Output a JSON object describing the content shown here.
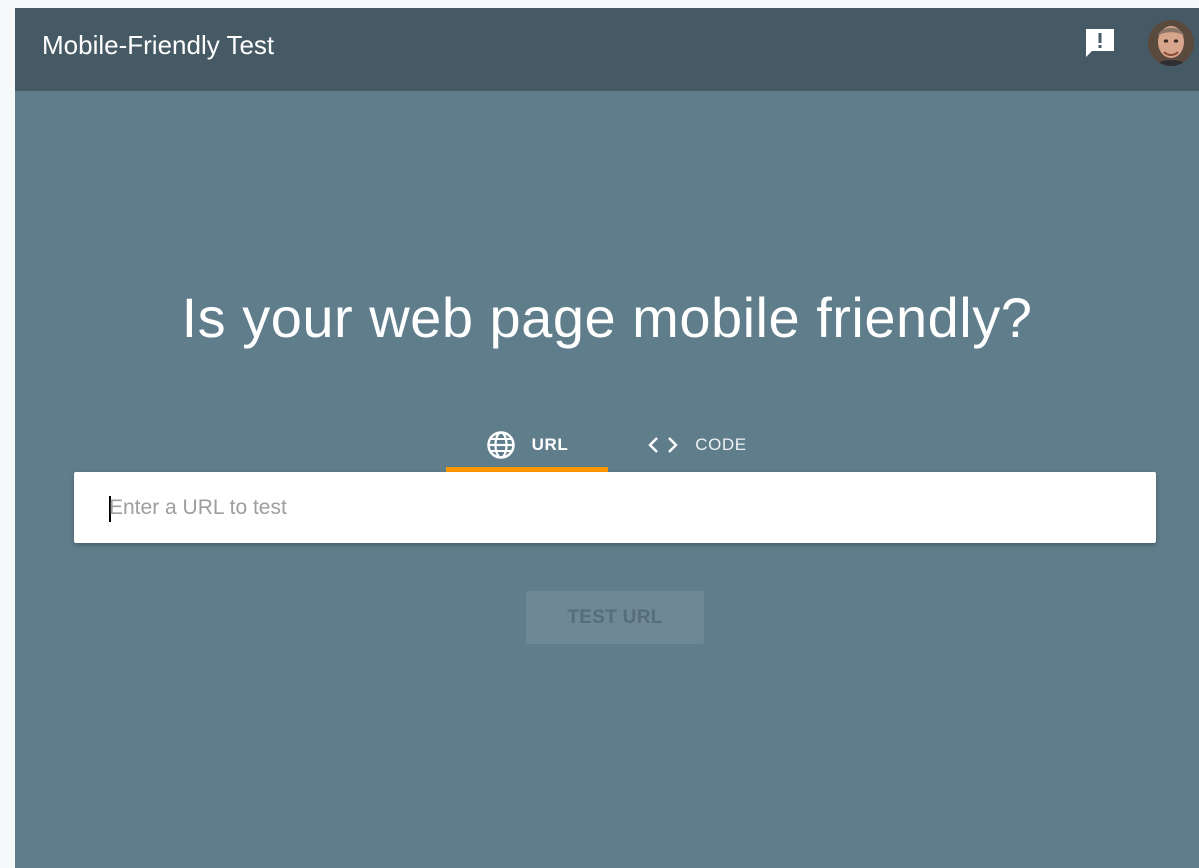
{
  "header": {
    "title": "Mobile-Friendly Test",
    "icons": [
      "feedback-icon",
      "avatar"
    ]
  },
  "main": {
    "headline": "Is your web page mobile friendly?",
    "tabs": [
      {
        "label": "URL",
        "icon": "globe-icon",
        "selected": true
      },
      {
        "label": "CODE",
        "icon": "code-icon",
        "selected": false
      }
    ],
    "url_input": {
      "value": "",
      "placeholder": "Enter a URL to test"
    },
    "test_button_label": "TEST URL"
  },
  "colors": {
    "page_background": "#607d8b",
    "header_background": "#455a64",
    "tab_indicator": "#ff9800",
    "input_background": "#ffffff",
    "button_background": "#6e8896"
  }
}
